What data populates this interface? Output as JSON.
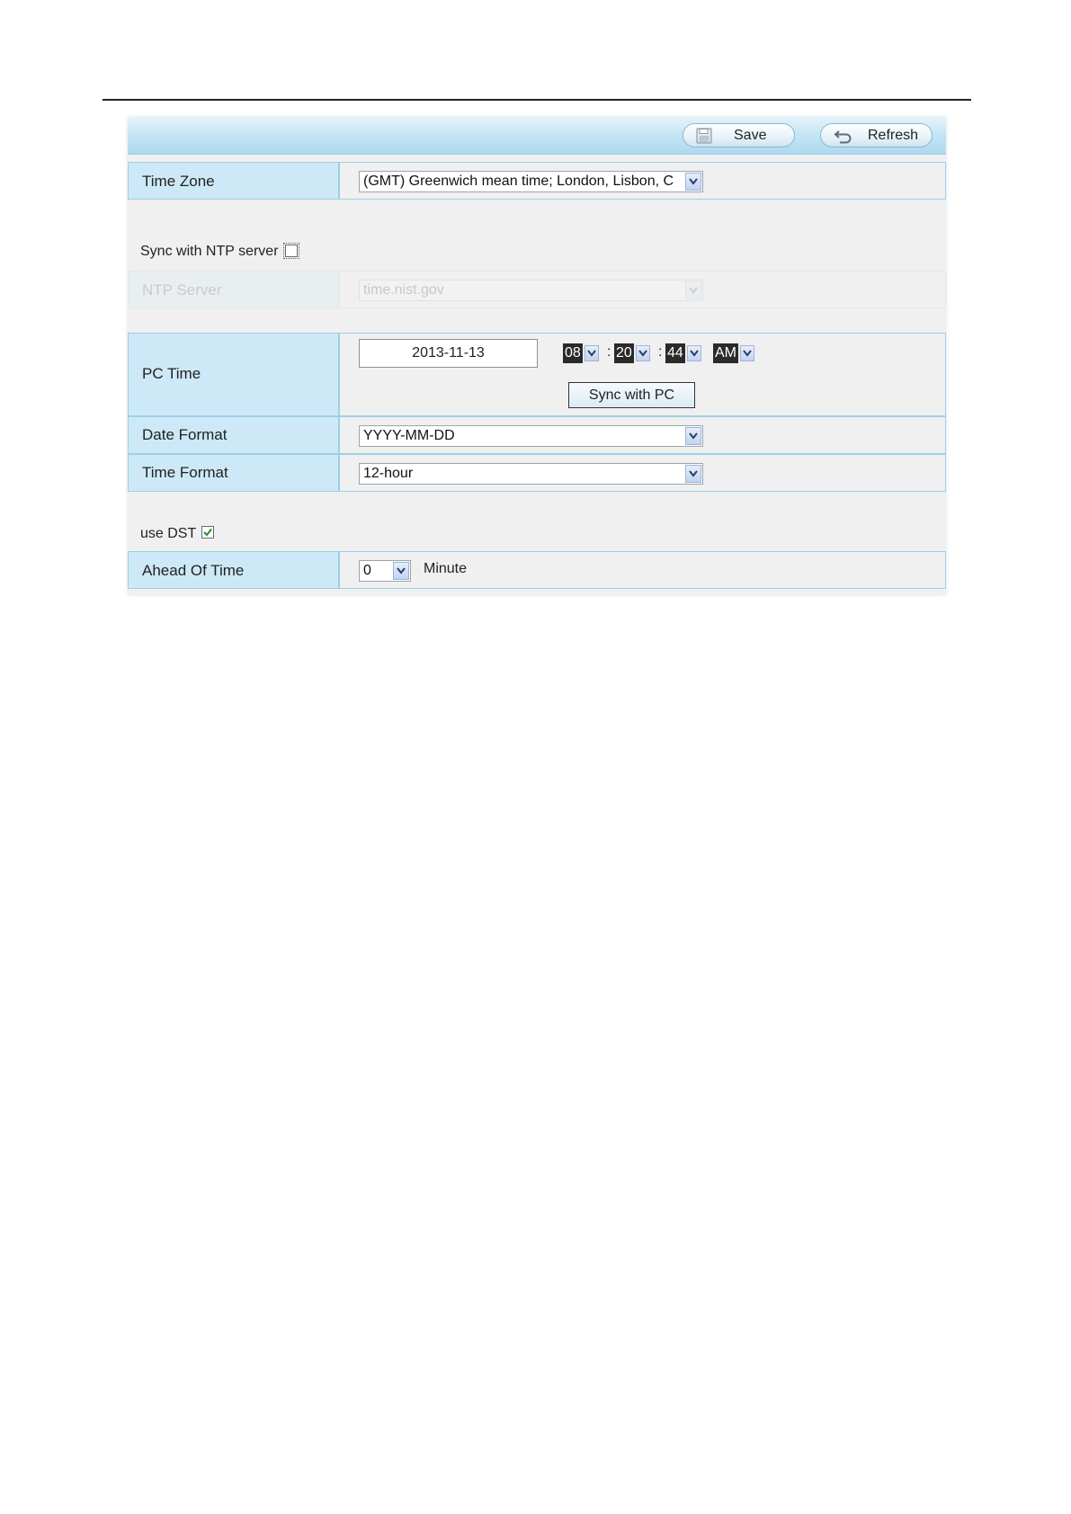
{
  "toolbar": {
    "save_label": "Save",
    "refresh_label": "Refresh"
  },
  "time_zone": {
    "label": "Time Zone",
    "value": "(GMT) Greenwich mean time; London, Lisbon, C"
  },
  "ntp": {
    "checkbox_label": "Sync with NTP server",
    "checked": false,
    "server_label": "NTP Server",
    "server_value": "time.nist.gov"
  },
  "pc_time": {
    "label": "PC Time",
    "date": "2013-11-13",
    "hour": "08",
    "minute": "20",
    "second": "44",
    "ampm": "AM",
    "sync_button": "Sync with PC"
  },
  "date_format": {
    "label": "Date Format",
    "value": "YYYY-MM-DD"
  },
  "time_format": {
    "label": "Time Format",
    "value": "12-hour"
  },
  "dst": {
    "checkbox_label": "use DST",
    "checked": true
  },
  "ahead_of_time": {
    "label": "Ahead Of Time",
    "value": "0",
    "unit": "Minute"
  },
  "colors": {
    "toolbar_gradient_top": "#e6f4fb",
    "toolbar_gradient_bottom": "#aed9ef",
    "label_cell_bg": "#cde9f7",
    "row_border": "#9fd0e6",
    "panel_bg": "#f0f0f0",
    "check_mark": "#2b8a2b"
  }
}
